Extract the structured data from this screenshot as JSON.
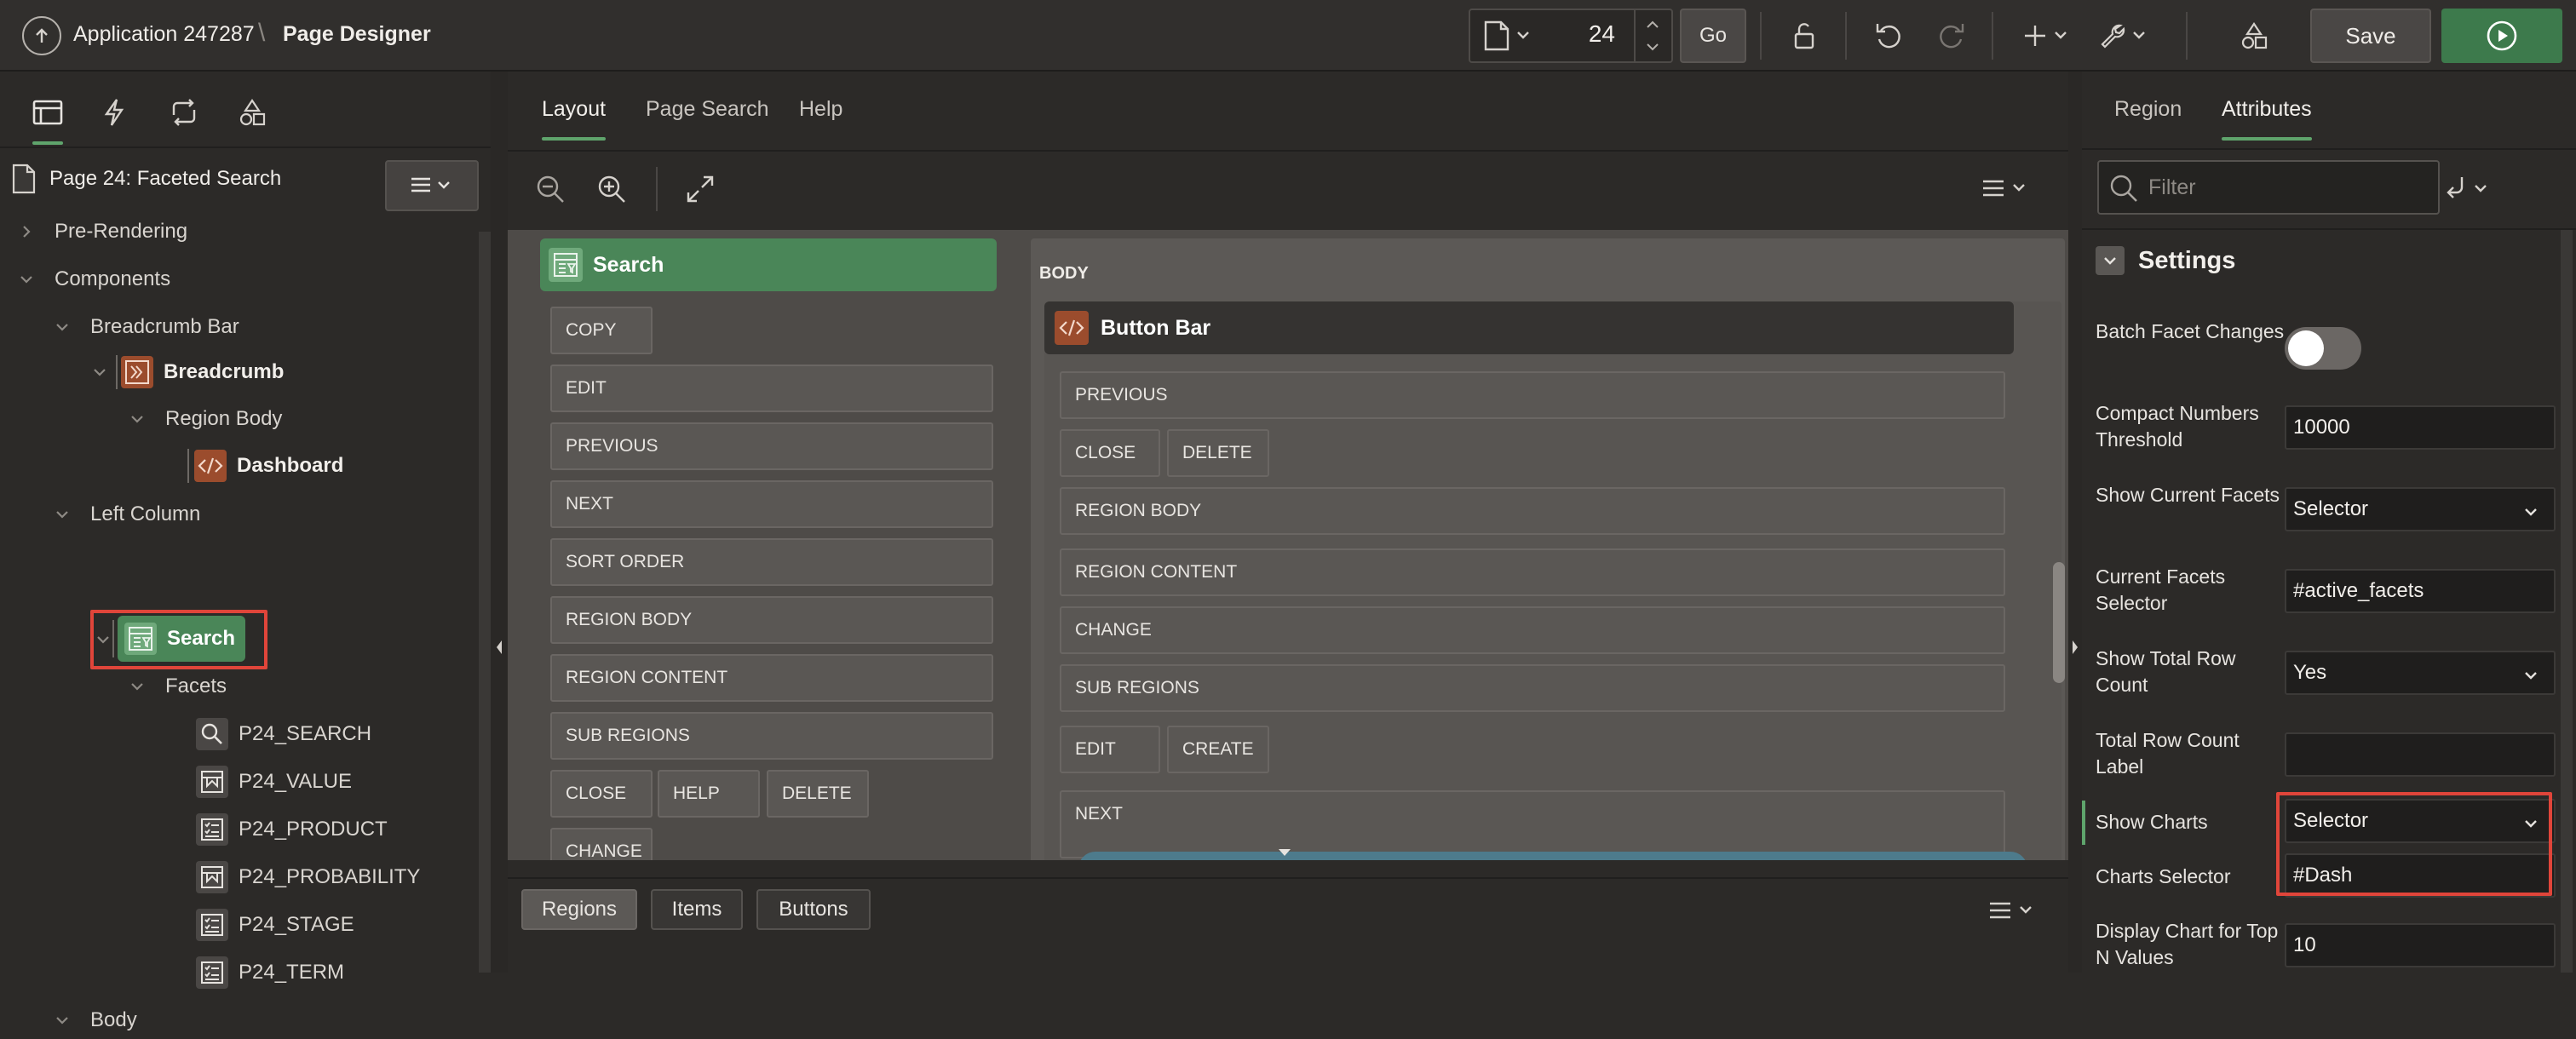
{
  "header": {
    "app_name": "Application 247287",
    "separator": "\\",
    "page_designer": "Page Designer",
    "page_number": "24",
    "go_label": "Go",
    "save_label": "Save"
  },
  "left_panel": {
    "page_title": "Page 24: Faceted Search",
    "tree": [
      {
        "label": "Pre-Rendering"
      },
      {
        "label": "Components"
      },
      {
        "label": "Breadcrumb Bar"
      },
      {
        "label": "Breadcrumb"
      },
      {
        "label": "Region Body"
      },
      {
        "label": "Dashboard"
      },
      {
        "label": "Left Column"
      },
      {
        "label": "Search"
      },
      {
        "label": "Facets"
      },
      {
        "label": "P24_SEARCH"
      },
      {
        "label": "P24_VALUE"
      },
      {
        "label": "P24_PRODUCT"
      },
      {
        "label": "P24_PROBABILITY"
      },
      {
        "label": "P24_STAGE"
      },
      {
        "label": "P24_TERM"
      },
      {
        "label": "Body"
      }
    ]
  },
  "center": {
    "tabs": [
      "Layout",
      "Page Search",
      "Help"
    ],
    "left_region_title": "Search",
    "left_slots": [
      "COPY",
      "EDIT",
      "PREVIOUS",
      "NEXT",
      "SORT ORDER",
      "REGION BODY",
      "REGION CONTENT",
      "SUB REGIONS",
      "CLOSE",
      "HELP",
      "DELETE",
      "CHANGE"
    ],
    "body_label": "BODY",
    "right_region_title": "Button Bar",
    "right_slots": [
      "PREVIOUS",
      "CLOSE",
      "DELETE",
      "REGION BODY",
      "REGION CONTENT",
      "CHANGE",
      "SUB REGIONS",
      "EDIT",
      "CREATE",
      "NEXT"
    ],
    "bottom_tabs": [
      "Regions",
      "Items",
      "Buttons"
    ]
  },
  "right_panel": {
    "tabs": [
      "Region",
      "Attributes"
    ],
    "filter_placeholder": "Filter",
    "section_title": "Settings",
    "props": [
      {
        "label": "Batch Facet Changes",
        "value": "",
        "type": "toggle",
        "on": false
      },
      {
        "label": "Compact Numbers Threshold",
        "value": "10000",
        "type": "text"
      },
      {
        "label": "Show Current Facets",
        "value": "Selector",
        "type": "select"
      },
      {
        "label": "Current Facets Selector",
        "value": "#active_facets",
        "type": "text"
      },
      {
        "label": "Show Total Row Count",
        "value": "Yes",
        "type": "select"
      },
      {
        "label": "Total Row Count Label",
        "value": "",
        "type": "text"
      },
      {
        "label": "Show Charts",
        "value": "Selector",
        "type": "select"
      },
      {
        "label": "Charts Selector",
        "value": "#Dash",
        "type": "text"
      },
      {
        "label": "Display Chart for Top N Values",
        "value": "10",
        "type": "text"
      }
    ]
  },
  "colors": {
    "accent_green": "#5fa46c",
    "highlight_red": "#e0453a",
    "orange_icon": "#9b4c2d"
  },
  "icons": [
    "arrow-up-icon",
    "page-icon",
    "chevron-up-icon",
    "chevron-down-icon",
    "unlock-icon",
    "undo-icon",
    "redo-icon",
    "plus-icon",
    "wrench-icon",
    "shapes-icon",
    "play-icon",
    "rendering-icon",
    "dynamic-actions-icon",
    "processing-icon",
    "shared-components-icon",
    "menu-icon",
    "zoom-out-icon",
    "zoom-in-icon",
    "expand-icon",
    "search-icon",
    "filter-icon",
    "return-icon"
  ]
}
